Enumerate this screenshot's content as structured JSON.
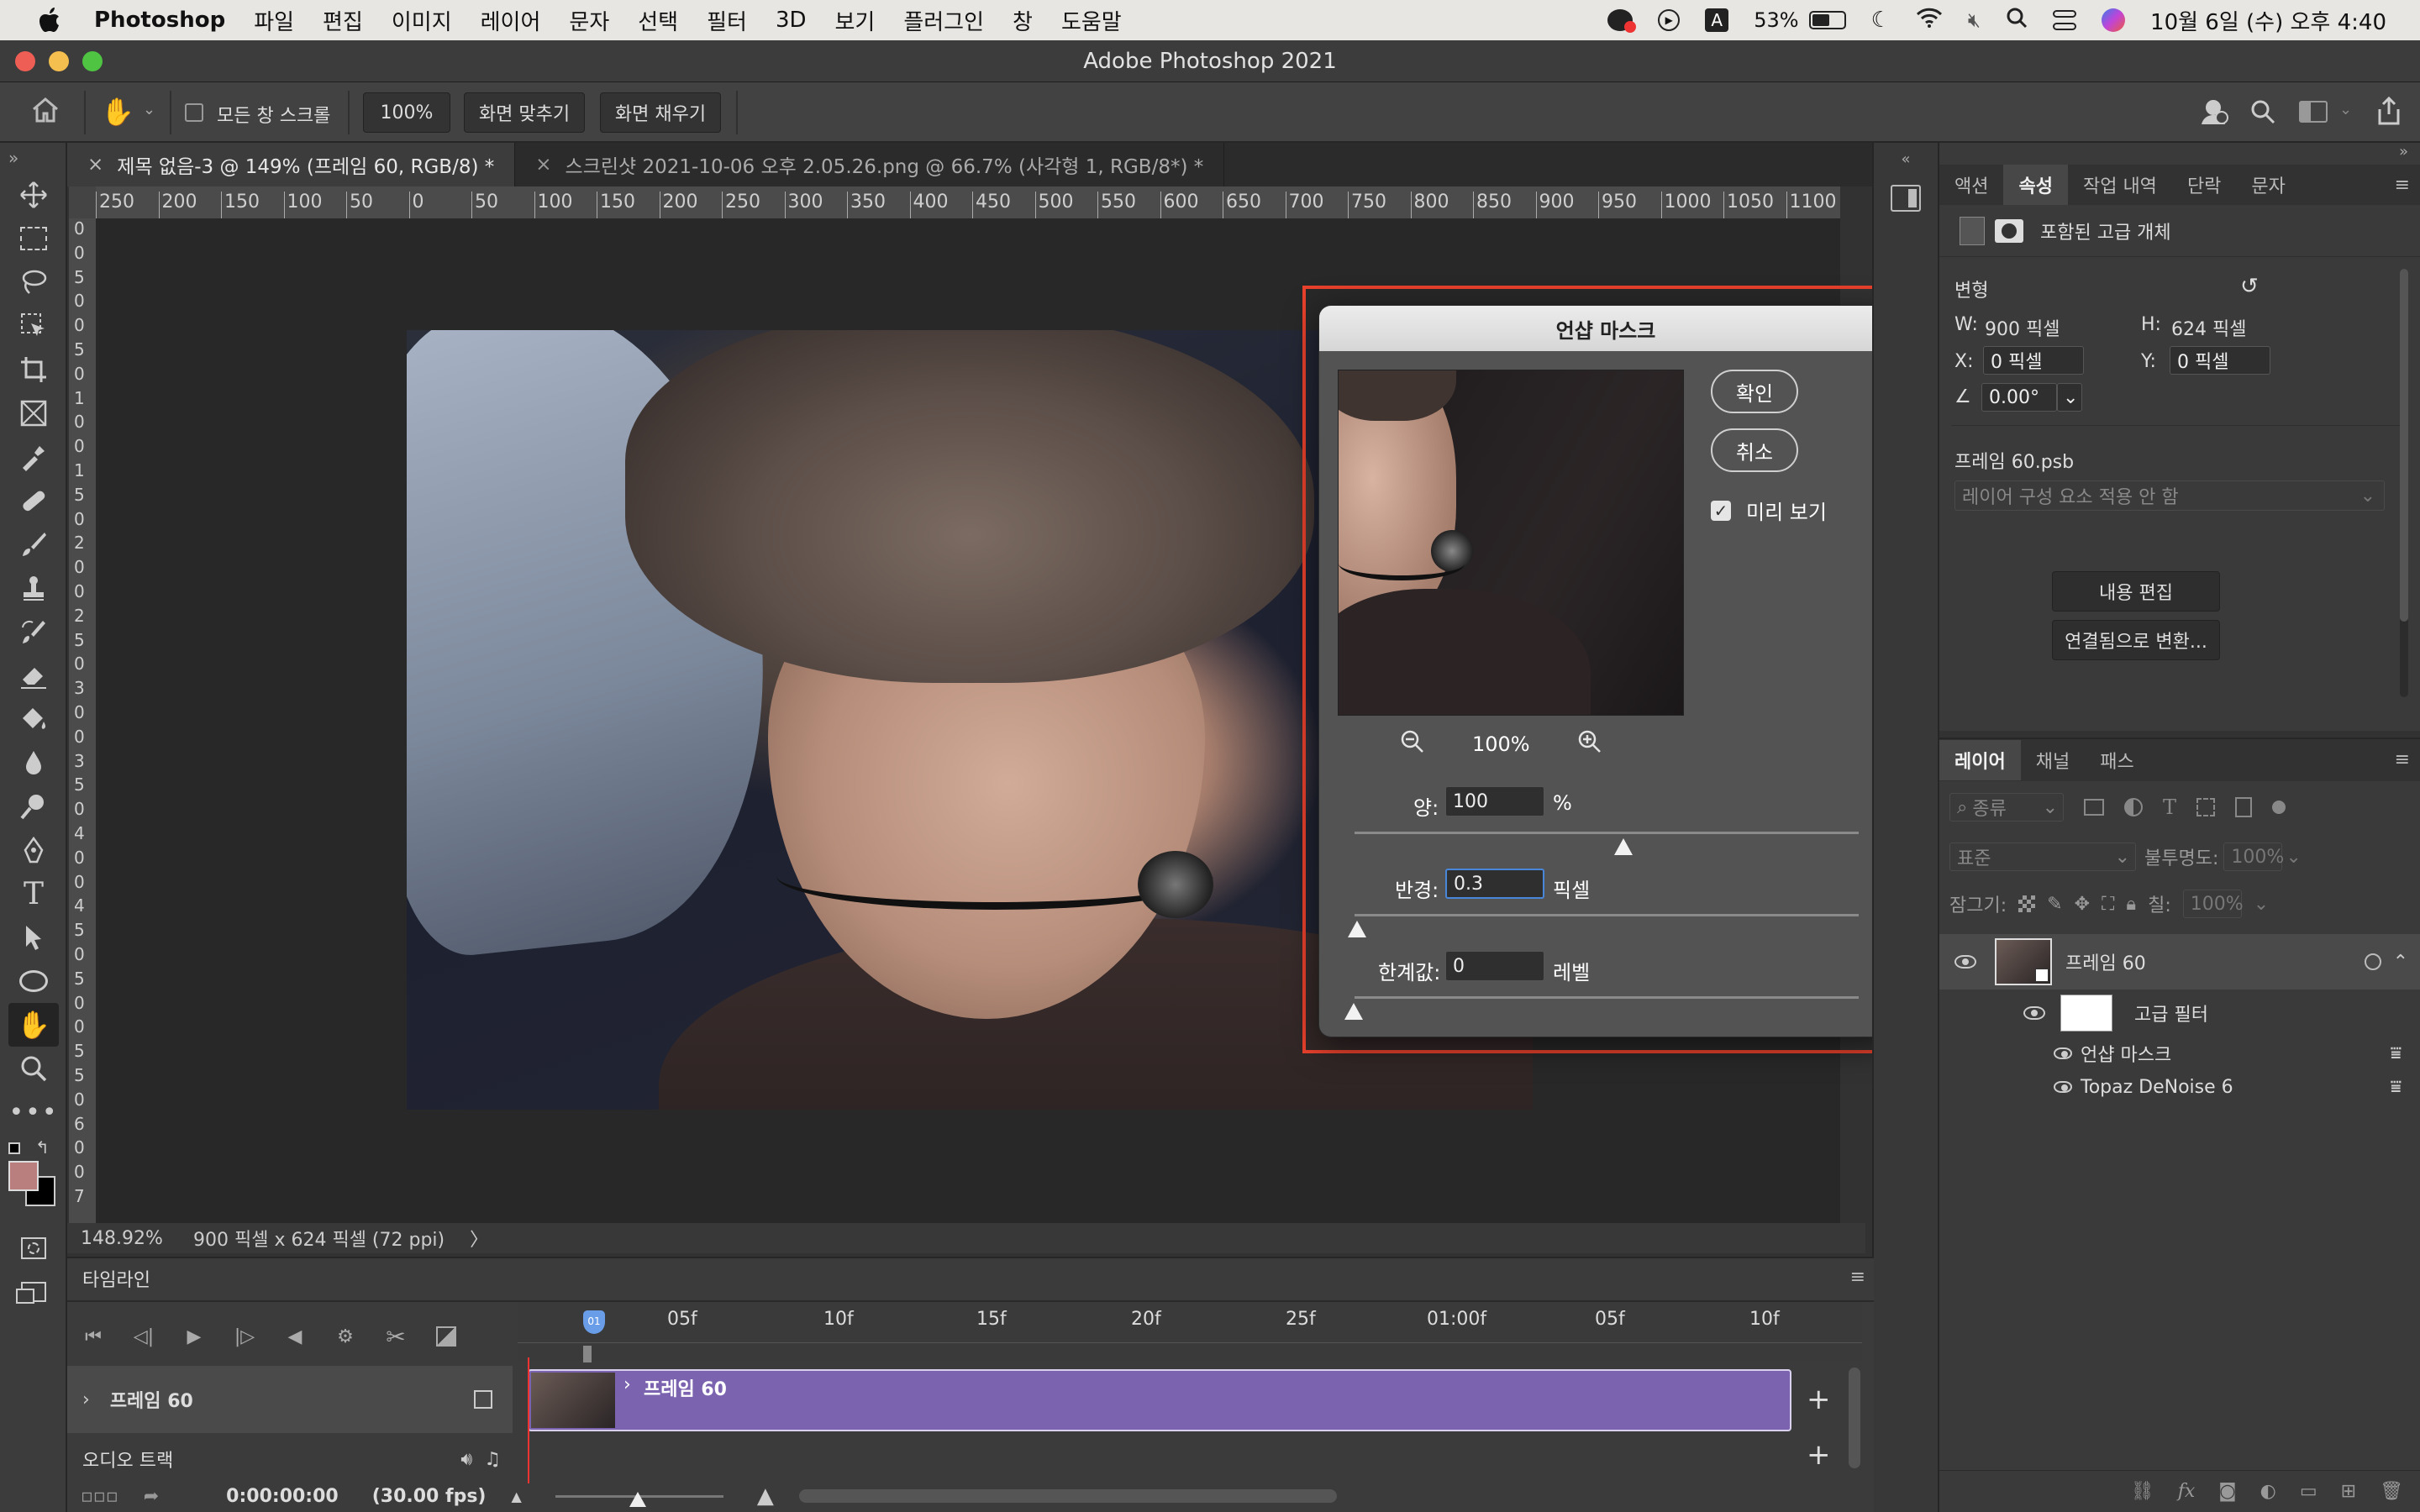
{
  "menubar": {
    "app": "Photoshop",
    "items": [
      "파일",
      "편집",
      "이미지",
      "레이어",
      "문자",
      "선택",
      "필터",
      "3D",
      "보기",
      "플러그인",
      "창",
      "도움말"
    ],
    "battery": "53%",
    "clock": "10월 6일 (수) 오후 4:40"
  },
  "window": {
    "title": "Adobe Photoshop 2021"
  },
  "options": {
    "scroll_all_label": "모든 창 스크롤",
    "zoom_value": "100%",
    "fit_screen": "화면 맞추기",
    "fill_screen": "화면 채우기"
  },
  "doc_tabs": [
    {
      "label": "제목 없음-3 @ 149% (프레임 60, RGB/8) *"
    },
    {
      "label": "스크린샷 2021-10-06 오후 2.05.26.png @ 66.7% (사각형 1, RGB/8*) *"
    }
  ],
  "ruler": {
    "h_ticks": [
      "250",
      "200",
      "150",
      "100",
      "50",
      "0",
      "50",
      "100",
      "150",
      "200",
      "250",
      "300",
      "350",
      "400",
      "450",
      "500",
      "550",
      "600",
      "650",
      "700",
      "750",
      "800",
      "850",
      "900",
      "950",
      "1000",
      "1050",
      "1100"
    ],
    "v_ticks": [
      "0",
      "0",
      "5",
      "0",
      "0",
      "5",
      "0",
      "1",
      "0",
      "0",
      "1",
      "5",
      "0",
      "2",
      "0",
      "0",
      "2",
      "5",
      "0",
      "3",
      "0",
      "0",
      "3",
      "5",
      "0",
      "4",
      "0",
      "0",
      "4",
      "5",
      "0",
      "5",
      "0",
      "0",
      "5",
      "5",
      "0",
      "6",
      "0",
      "0",
      "7"
    ]
  },
  "status": {
    "zoom": "148.92%",
    "doc_info": "900 픽셀 x 624 픽셀 (72 ppi)",
    "arrow": "〉"
  },
  "dialog": {
    "title": "언샵 마스크",
    "ok": "확인",
    "cancel": "취소",
    "preview_label": "미리 보기",
    "preview_checked": true,
    "zoom": "100%",
    "amount_label": "양:",
    "amount_value": "100",
    "amount_unit": "%",
    "radius_label": "반경:",
    "radius_value": "0.3",
    "radius_unit": "픽셀",
    "threshold_label": "한계값:",
    "threshold_value": "0",
    "threshold_unit": "레벨"
  },
  "props_panel": {
    "tabs": [
      "액션",
      "속성",
      "작업 내역",
      "단락",
      "문자"
    ],
    "active_tab": "속성",
    "object_type": "포함된 고급 개체",
    "transform_heading": "변형",
    "w_label": "W:",
    "w_value": "900 픽셀",
    "h_label": "H:",
    "h_value": "624 픽셀",
    "x_label": "X:",
    "x_value": "0 픽셀",
    "y_label": "Y:",
    "y_value": "0 픽셀",
    "angle_value": "0.00°",
    "filename": "프레임 60.psb",
    "comp_placeholder": "레이어 구성 요소 적용 안 함",
    "edit_contents": "내용 편집",
    "convert_linked": "연결됨으로 변환..."
  },
  "layers_panel": {
    "tabs": [
      "레이어",
      "채널",
      "패스"
    ],
    "active_tab": "레이어",
    "filter_placeholder": "종류",
    "blend_mode": "표준",
    "opacity_label": "불투명도:",
    "opacity_value": "100%",
    "lock_label": "잠그기:",
    "fill_label": "칠:",
    "fill_value": "100%",
    "layers": [
      {
        "name": "프레임 60"
      },
      {
        "name": "고급 필터"
      },
      {
        "name": "언샵 마스크"
      },
      {
        "name": "Topaz DeNoise 6"
      }
    ]
  },
  "timeline": {
    "title": "타임라인",
    "ruler_ticks": [
      "05f",
      "10f",
      "15f",
      "20f",
      "25f",
      "01:00f",
      "05f",
      "10f"
    ],
    "track_name": "프레임 60",
    "clip_name": "프레임 60",
    "audio_track": "오디오 트랙",
    "timecode": "0:00:00:00",
    "fps": "(30.00 fps)",
    "playhead_label": "01"
  },
  "colors": {
    "accent": "#e8412c",
    "clip": "#7b63b0",
    "foreground": "#b97e7e"
  }
}
